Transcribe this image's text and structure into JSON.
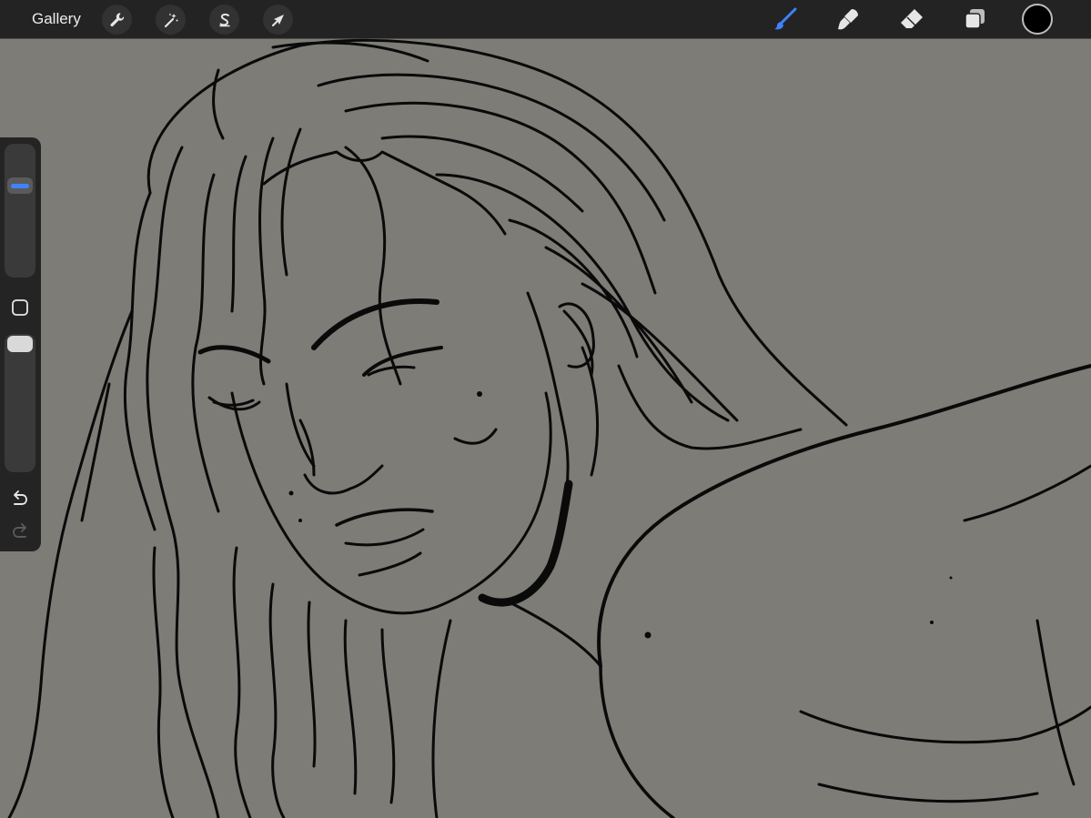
{
  "toolbar": {
    "gallery_label": "Gallery",
    "left_tools": [
      {
        "name": "actions",
        "icon": "wrench-icon"
      },
      {
        "name": "adjustments",
        "icon": "magic-wand-icon"
      },
      {
        "name": "selection",
        "icon": "selection-s-icon"
      },
      {
        "name": "transform",
        "icon": "arrow-cursor-icon"
      }
    ],
    "right_tools": [
      {
        "name": "brush",
        "icon": "brush-icon",
        "active": true
      },
      {
        "name": "smudge",
        "icon": "smudge-icon",
        "active": false
      },
      {
        "name": "eraser",
        "icon": "eraser-icon",
        "active": false
      },
      {
        "name": "layers",
        "icon": "layers-icon",
        "active": false
      }
    ],
    "current_color": "#000000",
    "active_color": "#3e82ff"
  },
  "sidebar": {
    "brush_size": 0.72,
    "opacity": 1.0,
    "icons": [
      "modify-square-icon",
      "undo-icon",
      "redo-icon"
    ]
  },
  "canvas": {
    "background_color": "#7d7c76",
    "line_color": "#0a0a0a"
  }
}
